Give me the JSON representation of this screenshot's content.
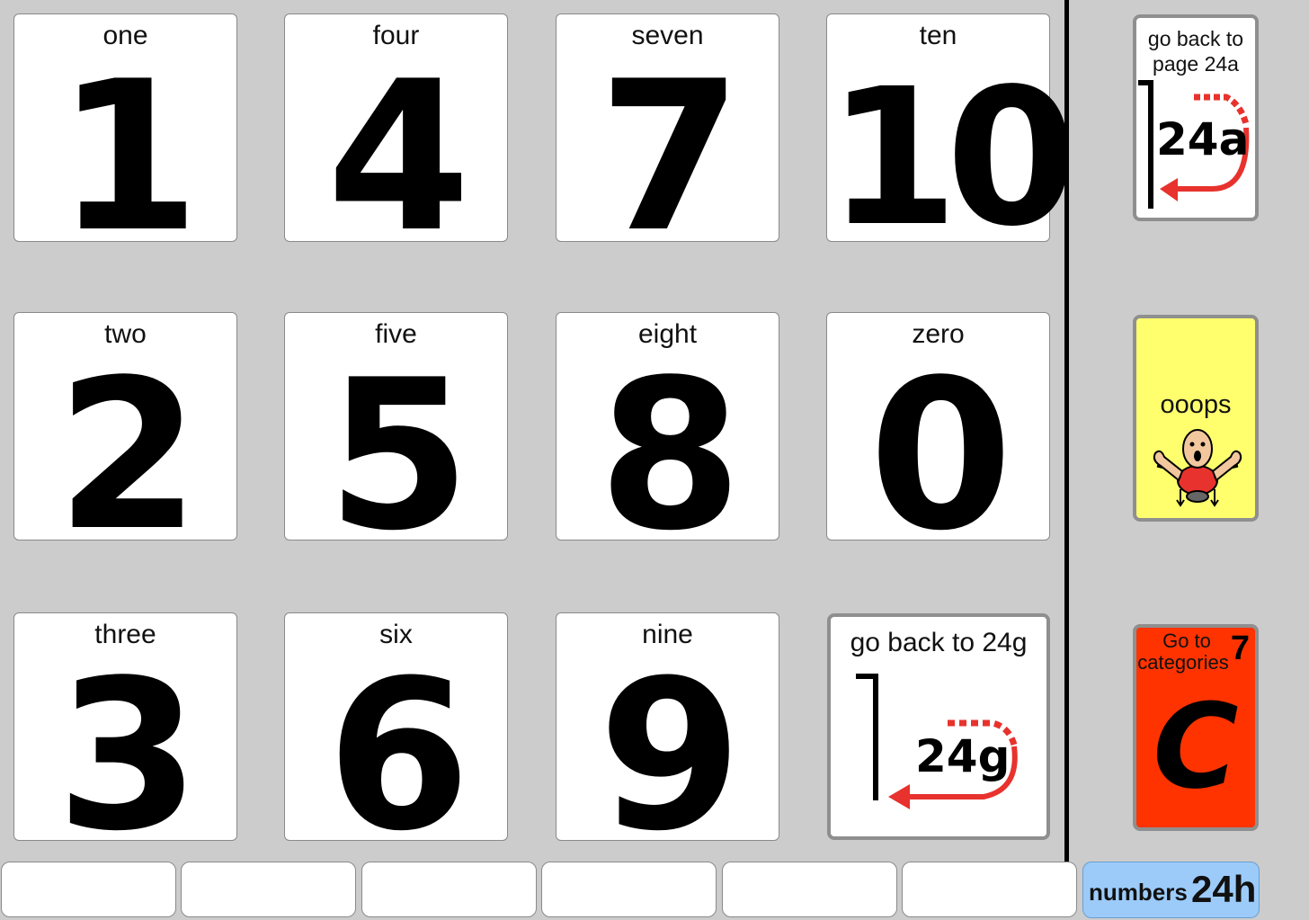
{
  "grid": {
    "cells": [
      {
        "label": "one",
        "digit": "1"
      },
      {
        "label": "two",
        "digit": "2"
      },
      {
        "label": "three",
        "digit": "3"
      },
      {
        "label": "four",
        "digit": "4"
      },
      {
        "label": "five",
        "digit": "5"
      },
      {
        "label": "six",
        "digit": "6"
      },
      {
        "label": "seven",
        "digit": "7"
      },
      {
        "label": "eight",
        "digit": "8"
      },
      {
        "label": "nine",
        "digit": "9"
      },
      {
        "label": "ten",
        "digit": "10"
      },
      {
        "label": "zero",
        "digit": "0"
      }
    ],
    "back_button": {
      "label": "go back to 24g",
      "page": "24g"
    }
  },
  "sidebar": {
    "back_page": {
      "label_line1": "go back to",
      "label_line2": "page 24a",
      "page": "24a"
    },
    "ooops": {
      "label": "ooops",
      "color": "#ffff6e"
    },
    "categories": {
      "label_line1": "Go to",
      "label_line2": "categories",
      "number": "7",
      "letter": "C",
      "color": "#ff3300"
    }
  },
  "footer": {
    "page_word": "numbers",
    "page_id": "24h",
    "tag_color": "#9ccbfa"
  }
}
